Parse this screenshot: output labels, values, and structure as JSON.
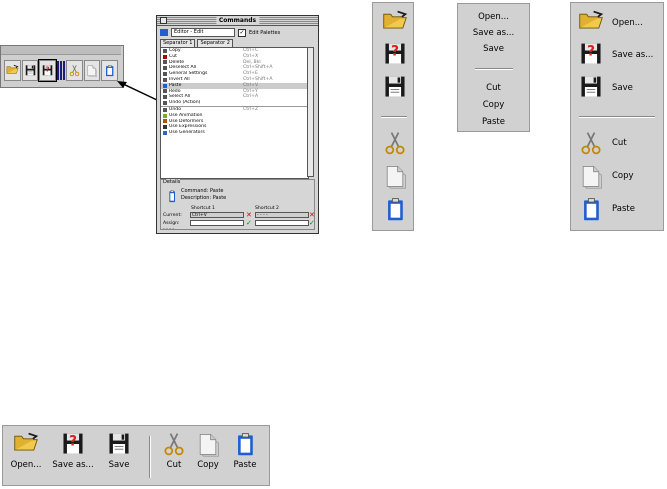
{
  "window": {
    "title": "Commands",
    "context_select": "Editor - Edit",
    "edit_palettes_label": "Edit Palettes",
    "tabs": [
      "Separator 1",
      "Separator 2"
    ],
    "commands": [
      {
        "name": "Copy",
        "shortcut": "Ctrl+C"
      },
      {
        "name": "Cut",
        "shortcut": "Ctrl+X"
      },
      {
        "name": "Delete",
        "shortcut": "Del, Bkl"
      },
      {
        "name": "Deselect All",
        "shortcut": "Ctrl+Shift+A"
      },
      {
        "name": "General Settings",
        "shortcut": "Ctrl+E"
      },
      {
        "name": "Invert All",
        "shortcut": "Ctrl+Shift+A"
      },
      {
        "name": "Paste",
        "shortcut": "Ctrl+V"
      },
      {
        "name": "Redo",
        "shortcut": "Ctrl+Y"
      },
      {
        "name": "Select All",
        "shortcut": "Ctrl+A"
      },
      {
        "name": "Undo (Action)",
        "shortcut": ""
      },
      {
        "name": "Undo",
        "shortcut": "Ctrl+Z"
      },
      {
        "name": "Use Animation",
        "shortcut": ""
      },
      {
        "name": "Use Deformers",
        "shortcut": ""
      },
      {
        "name": "Use Expressions",
        "shortcut": ""
      },
      {
        "name": "Use Generators",
        "shortcut": ""
      }
    ],
    "details": {
      "title": "Details",
      "command_label": "Command:",
      "command_value": "Paste",
      "description_label": "Description:",
      "description_value": "Paste",
      "shortcut1_label": "Shortcut 1",
      "shortcut2_label": "Shortcut 2",
      "current_label": "Current:",
      "current_value1": "Ctrl+V",
      "current_value2": "- - - -",
      "assign_label": "Assign:",
      "footer": "- - - -"
    }
  },
  "menu_text": {
    "items": [
      "Open...",
      "Save as...",
      "Save",
      "Cut",
      "Copy",
      "Paste"
    ]
  },
  "labeled_palette": {
    "items": [
      "Open...",
      "Save as...",
      "Save",
      "Cut",
      "Copy",
      "Paste"
    ]
  },
  "bottom_palette": {
    "items": [
      "Open...",
      "Save as...",
      "Save",
      "Cut",
      "Copy",
      "Paste"
    ]
  },
  "colors": {
    "panel": "#d1d1d1",
    "folder": "#f2c94c",
    "floppy": "#1a1a1a",
    "help_red": "#d22",
    "paste_blue": "#1f5fd1"
  },
  "icons": [
    "open-folder-icon",
    "save-as-icon",
    "save-icon",
    "cut-icon",
    "copy-icon",
    "paste-icon"
  ]
}
